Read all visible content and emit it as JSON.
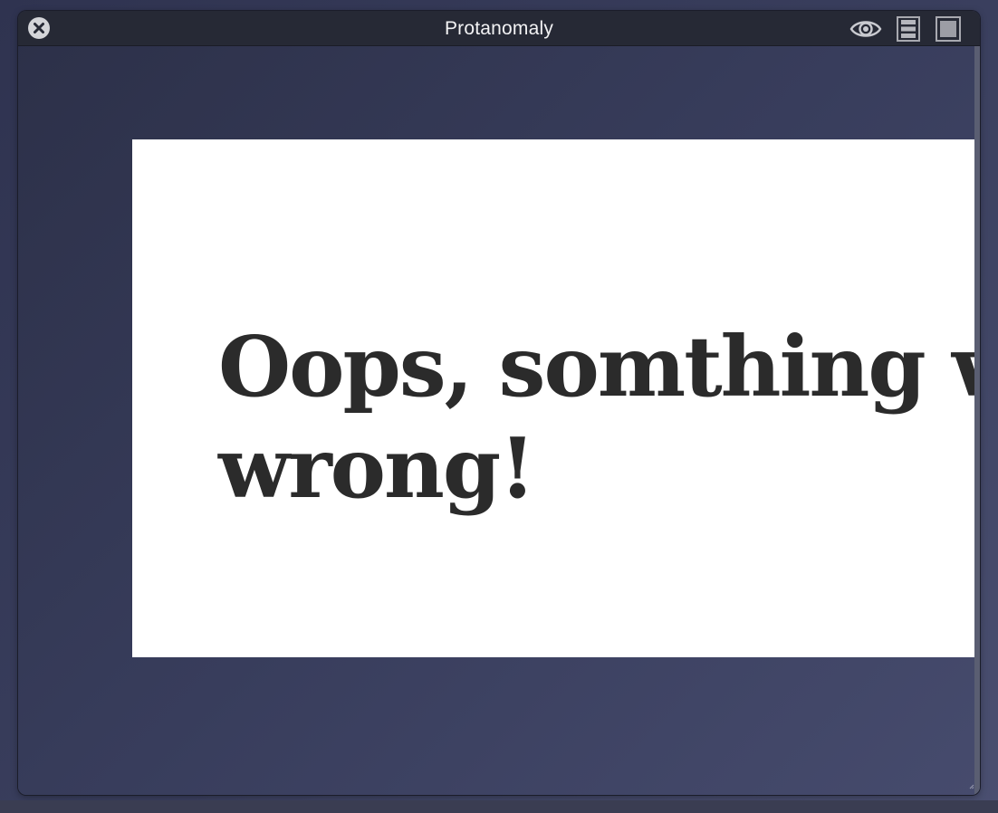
{
  "window": {
    "title": "Protanomaly"
  },
  "toolbar": {
    "close_icon": "close-circle-icon",
    "eye_icon": "eye-icon",
    "list_icon": "list-view-icon",
    "frame_icon": "frame-view-icon"
  },
  "preview": {
    "heading_line1": "Oops, somthing went",
    "heading_line2": "wrong!"
  },
  "colors": {
    "titlebar": "#262935",
    "background_gradient_start": "#2c3048",
    "background_gradient_end": "#464b6d",
    "preview_background": "#ffffff",
    "heading_text": "#2b2b2b",
    "title_text": "#f2f2f4"
  }
}
